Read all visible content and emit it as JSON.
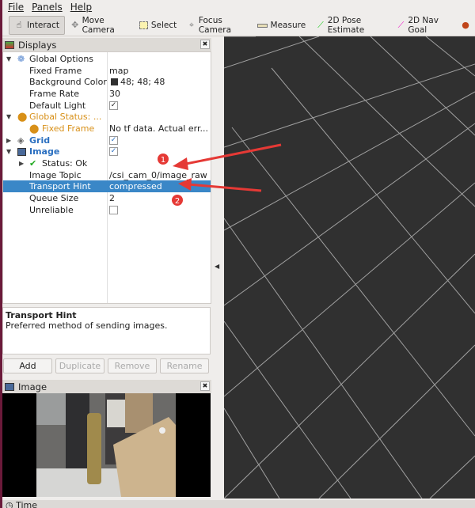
{
  "menu": [
    "File",
    "Panels",
    "Help"
  ],
  "toolbar": [
    {
      "label": "Interact",
      "icon": "hand-icon",
      "active": true
    },
    {
      "label": "Move Camera",
      "icon": "move-icon"
    },
    {
      "label": "Select",
      "icon": "select-icon"
    },
    {
      "label": "Focus Camera",
      "icon": "focus-icon"
    },
    {
      "label": "Measure",
      "icon": "ruler-icon"
    },
    {
      "label": "2D Pose Estimate",
      "icon": "green-arrow-icon"
    },
    {
      "label": "2D Nav Goal",
      "icon": "pink-arrow-icon"
    }
  ],
  "displays": {
    "title": "Displays",
    "rows": [
      {
        "key": "Global Options",
        "value": ""
      },
      {
        "key": "Fixed Frame",
        "value": "map"
      },
      {
        "key": "Background Color",
        "value": "48; 48; 48"
      },
      {
        "key": "Frame Rate",
        "value": "30"
      },
      {
        "key": "Default Light",
        "value": "checked"
      },
      {
        "key": "Global Status: ...",
        "value": ""
      },
      {
        "key": "Fixed Frame",
        "value": "No tf data.  Actual err..."
      },
      {
        "key": "Grid",
        "value": "checked"
      },
      {
        "key": "Image",
        "value": "checked"
      },
      {
        "key": "Status: Ok",
        "value": ""
      },
      {
        "key": "Image Topic",
        "value": "/csi_cam_0/image_raw"
      },
      {
        "key": "Transport Hint",
        "value": "compressed"
      },
      {
        "key": "Queue Size",
        "value": "2"
      },
      {
        "key": "Unreliable",
        "value": "unchecked"
      }
    ],
    "background_color": "#303030"
  },
  "description": {
    "title": "Transport Hint",
    "text": "Preferred method of sending images."
  },
  "buttons": {
    "add": "Add",
    "duplicate": "Duplicate",
    "remove": "Remove",
    "rename": "Rename"
  },
  "image_panel": {
    "title": "Image"
  },
  "time_panel": {
    "title": "Time"
  },
  "annotations": {
    "one": "1",
    "two": "2",
    "color": "#e53935"
  }
}
